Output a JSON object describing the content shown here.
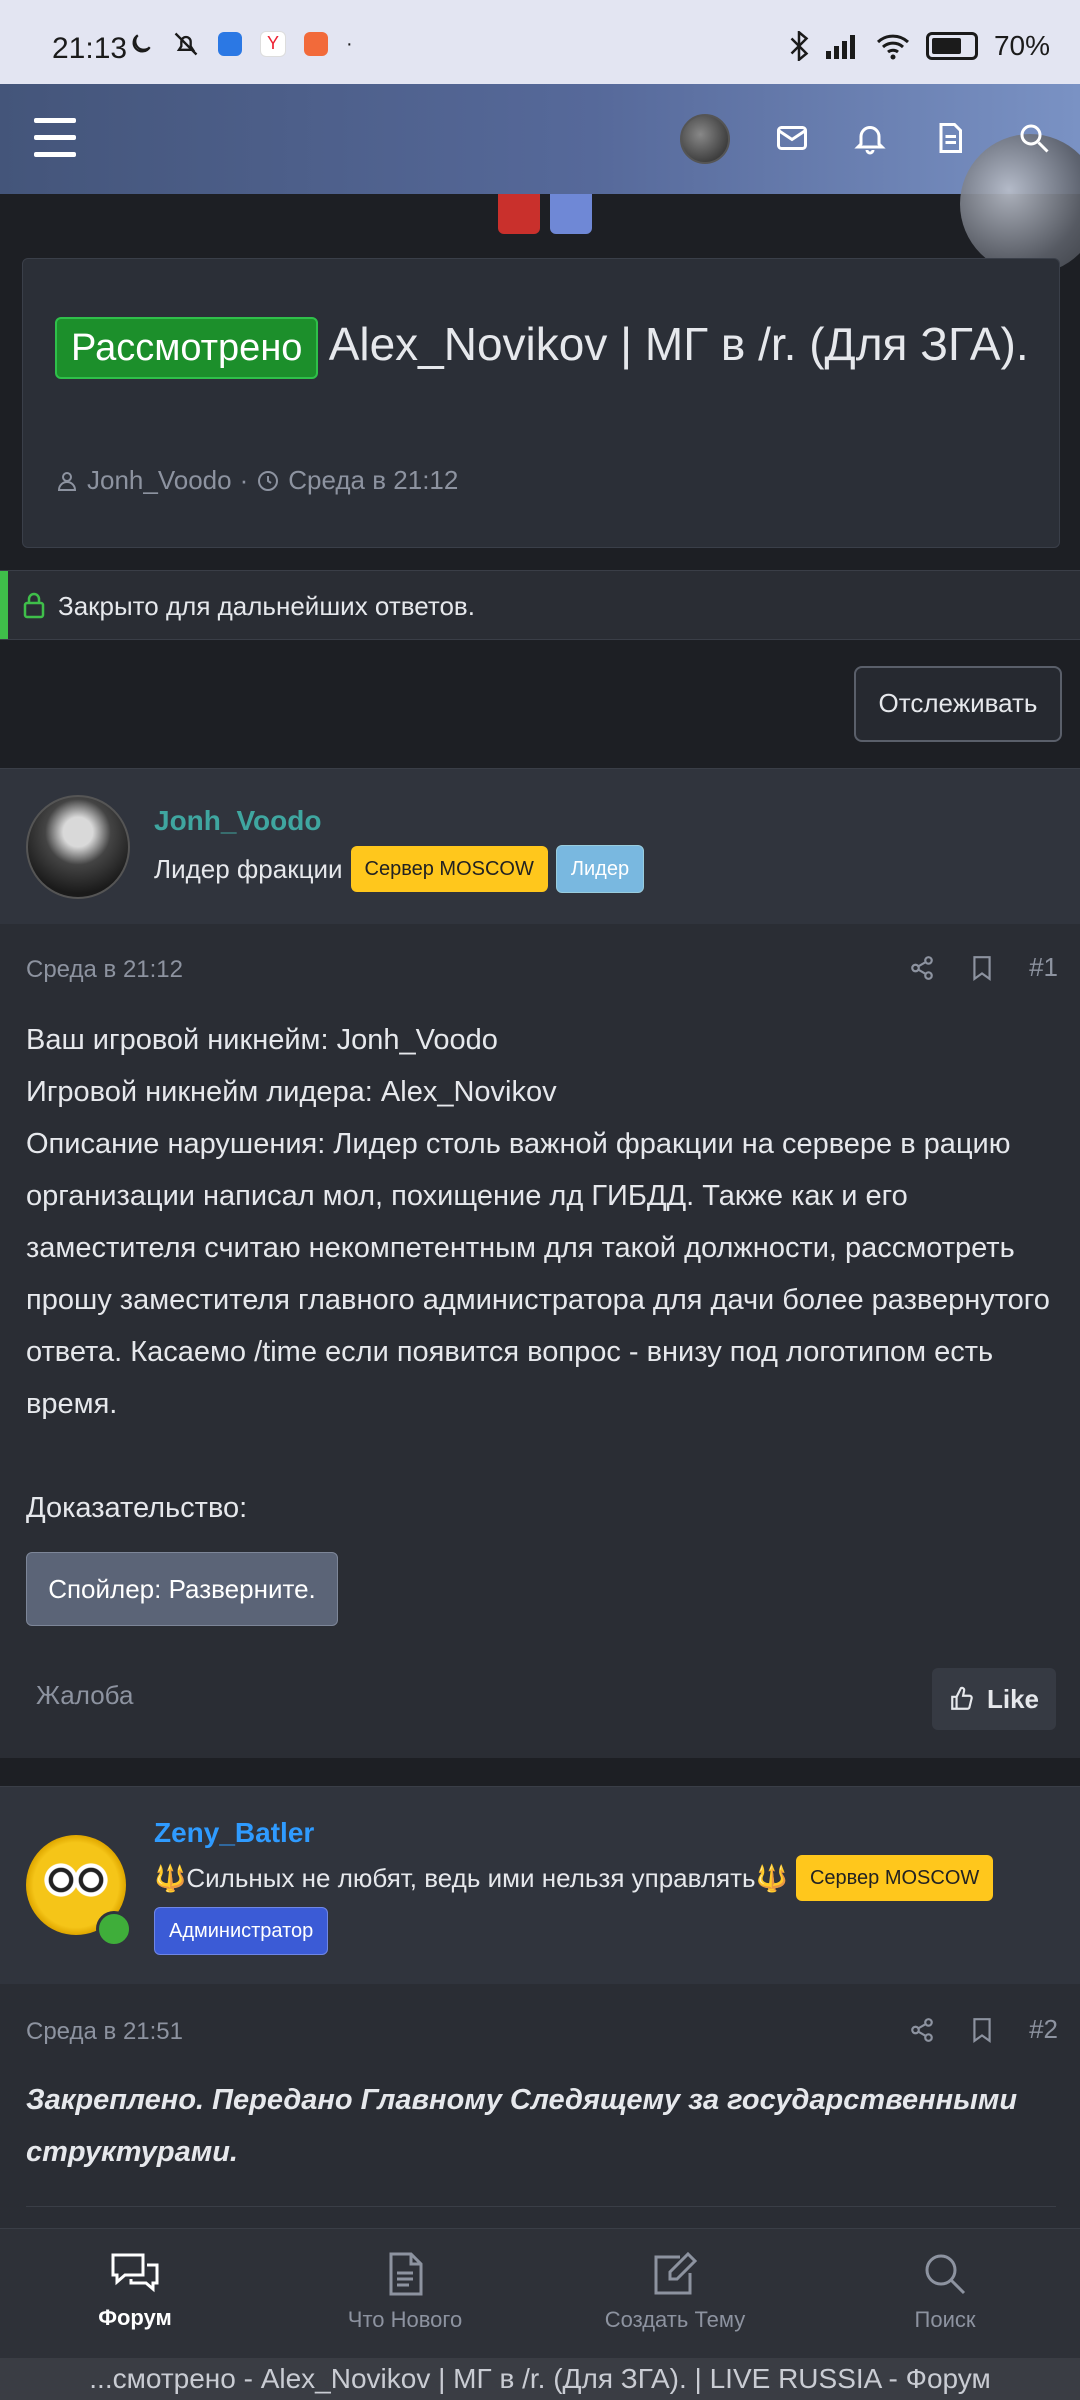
{
  "status_bar": {
    "time": "21:13",
    "battery": "70%"
  },
  "thread": {
    "badge": "Рассмотрено",
    "title": "Alex_Novikov | МГ в /r. (Для ЗГА).",
    "author": "Jonh_Voodo",
    "date": "Среда в 21:12",
    "closed_notice": "Закрыто для дальнейших ответов.",
    "watch_label": "Отслеживать"
  },
  "posts": [
    {
      "username": "Jonh_Voodo",
      "user_title": "Лидер фракции",
      "tags": [
        "Сервер MOSCOW",
        "Лидер"
      ],
      "date": "Среда в 21:12",
      "number": "#1",
      "lines": [
        "Ваш игровой никнейм: Jonh_Voodo",
        "Игровой никнейм лидера: Alex_Novikov",
        "Описание нарушения: Лидер столь важной фракции на сервере в рацию организации написал мол, похищение лд ГИБДД. Также как и его заместителя считаю некомпетентным для такой должности, рассмотреть прошу заместителя главного администратора для дачи более развернутого ответа. Касаемо /time если появится вопрос - внизу под логотипом есть время.",
        "Доказательство:"
      ],
      "spoiler": "Спойлер: Разверните.",
      "report": "Жалоба",
      "like": "Like"
    },
    {
      "username": "Zeny_Batler",
      "user_title": "🔱Сильных не любят, ведь ими нельзя управлять🔱",
      "tags": [
        "Сервер MOSCOW",
        "Администратор"
      ],
      "date": "Среда в 21:51",
      "number": "#2",
      "content": "Закреплено. Передано Главному Следящему за государственными структурами."
    }
  ],
  "tabs": [
    {
      "label": "Форум",
      "icon": "forum-icon"
    },
    {
      "label": "Что Нового",
      "icon": "document-icon"
    },
    {
      "label": "Создать Тему",
      "icon": "edit-icon"
    },
    {
      "label": "Поиск",
      "icon": "search-icon"
    }
  ],
  "url_bar": "...смотрено - Alex_Novikov | МГ в /r. (Для ЗГА). | LIVE RUSSIA - Форум",
  "colors": {
    "accent_green": "#1c8f2b",
    "username_teal": "#3fa6a0",
    "username_blue": "#2f9bff",
    "pill_yellow": "#ffc71c"
  }
}
